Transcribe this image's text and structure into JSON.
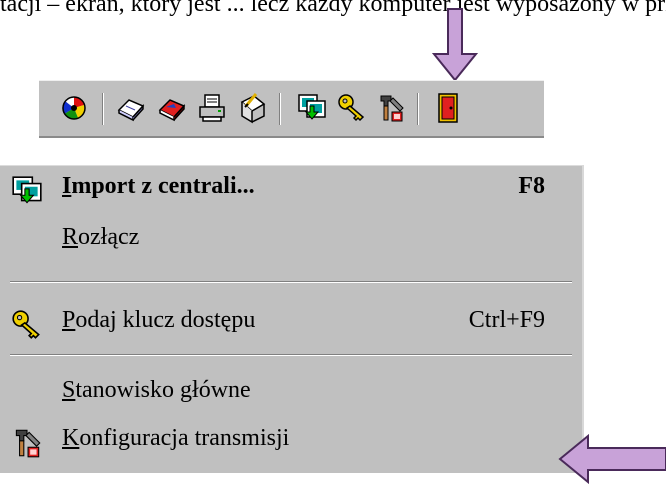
{
  "top_text": "tacji – ekran, który jest ... lecz każdy komputer jest wyposażony w przycisk, który otwiera okno dostępu do ustawień, w którym należy wpisać informacje dotyczące transmisji sp...",
  "toolbar": {
    "buttons": [
      {
        "icon": "color-wheel-icon"
      },
      {
        "icon": "open-book-icon"
      },
      {
        "icon": "red-book-icon"
      },
      {
        "icon": "printer-icon"
      },
      {
        "icon": "edit-document-icon"
      },
      {
        "icon": "import-download-icon"
      },
      {
        "icon": "key-icon"
      },
      {
        "icon": "tools-hammer-icon"
      },
      {
        "icon": "exit-door-icon"
      }
    ]
  },
  "menu": {
    "items": [
      {
        "label_acc": "I",
        "label_rest": "mport z centrali...",
        "shortcut": "F8",
        "icon": "import-download-icon"
      },
      {
        "label_acc": "R",
        "label_rest": "ozłącz",
        "shortcut": ""
      },
      {
        "label_acc": "P",
        "label_rest": "odaj klucz dostępu",
        "shortcut": "Ctrl+F9",
        "icon": "key-icon"
      },
      {
        "label_acc": "S",
        "label_rest": "tanowisko główne",
        "shortcut": ""
      },
      {
        "label_acc": "K",
        "label_rest": "onfiguracja transmisji",
        "shortcut": "",
        "icon": "tools-hammer-icon"
      }
    ]
  },
  "colors": {
    "menu_bg": "#c0c0c0",
    "arrow_fill": "#c8a2d8",
    "arrow_stroke": "#4a2a5a"
  }
}
